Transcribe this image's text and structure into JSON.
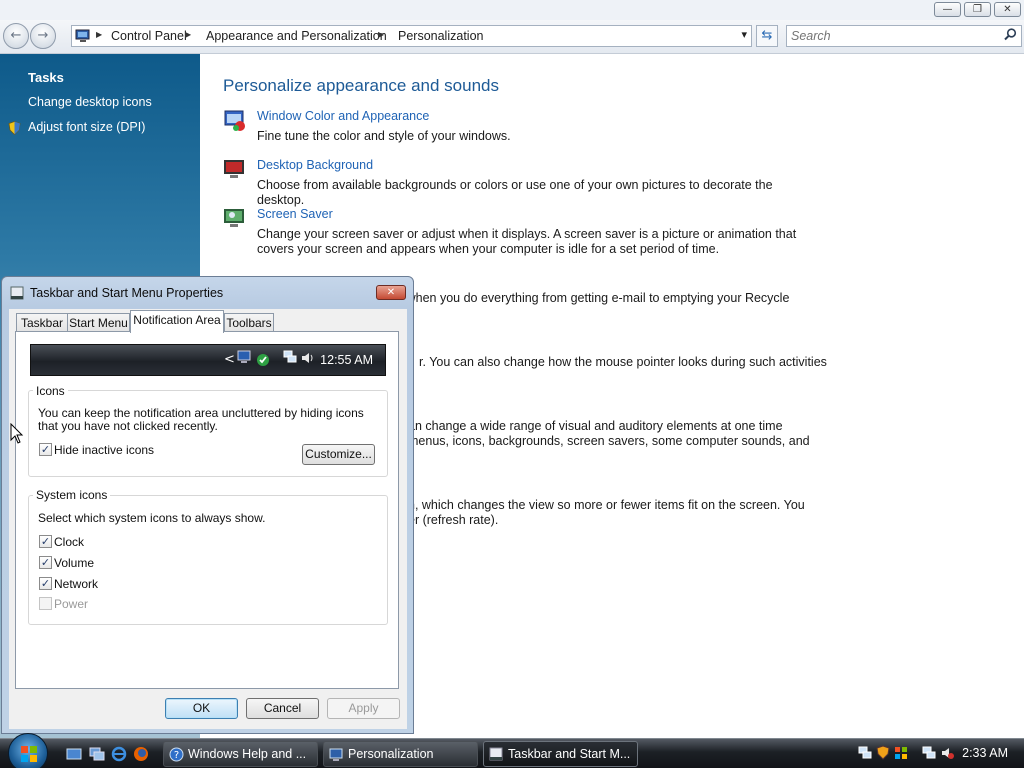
{
  "window": {
    "minimize_glyph": "—",
    "maximize_glyph": "❐",
    "close_glyph": "✕"
  },
  "address_bar": {
    "back_glyph": "←",
    "forward_glyph": "→",
    "crumbs": [
      "Control Panel",
      "Appearance and Personalization",
      "Personalization"
    ],
    "dropdown_glyph": "▾",
    "refresh_glyph": "⇆"
  },
  "search": {
    "placeholder": "Search",
    "icon": "search-icon"
  },
  "left_pane": {
    "heading": "Tasks",
    "tasks": [
      {
        "label": "Change desktop icons"
      },
      {
        "label": "Adjust font size (DPI)",
        "icon": "shield-icon"
      }
    ]
  },
  "content": {
    "title": "Personalize appearance and sounds",
    "items": [
      {
        "title": "Window Color and Appearance",
        "description": "Fine tune the color and style of your windows."
      },
      {
        "title": "Desktop Background",
        "description": "Choose from available backgrounds or colors or use one of your own pictures to decorate the desktop."
      },
      {
        "title": "Screen Saver",
        "description": "Change your screen saver or adjust when it displays. A screen saver is a picture or animation that covers your screen and appears when your computer is idle for a set period of time."
      }
    ],
    "partial_lines": [
      "rd when you do everything from getting e-mail to emptying your Recycle",
      "r. You can also change how the mouse pointer looks during such activities",
      "an change a wide range of visual and auditory elements at one time",
      "menus, icons, backgrounds, screen savers, some computer sounds, and",
      "n, which changes the view so more or fewer items fit on the screen. You",
      "er (refresh rate)."
    ]
  },
  "dialog": {
    "title": "Taskbar and Start Menu Properties",
    "close_glyph": "✕",
    "tabs": [
      "Taskbar",
      "Start Menu",
      "Notification Area",
      "Toolbars"
    ],
    "active_tab": "Notification Area",
    "preview": {
      "chevron": "<",
      "clock": "12:55 AM"
    },
    "icons_group": {
      "title": "Icons",
      "description": "You can keep the notification area uncluttered by hiding icons that you have not clicked recently.",
      "hide_inactive": {
        "label": "Hide inactive icons",
        "checked": true
      },
      "customize_label": "Customize..."
    },
    "system_icons_group": {
      "title": "System icons",
      "description": "Select which system icons to always show.",
      "options": [
        {
          "label": "Clock",
          "checked": true,
          "enabled": true
        },
        {
          "label": "Volume",
          "checked": true,
          "enabled": true
        },
        {
          "label": "Network",
          "checked": true,
          "enabled": true
        },
        {
          "label": "Power",
          "checked": false,
          "enabled": false
        }
      ]
    },
    "buttons": {
      "ok": "OK",
      "cancel": "Cancel",
      "apply": "Apply"
    },
    "check_glyph": "✓"
  },
  "taskbar": {
    "buttons": [
      {
        "label": "Windows Help and ...",
        "icon": "help-icon"
      },
      {
        "label": "Personalization",
        "icon": "control-panel-icon"
      },
      {
        "label": "Taskbar and Start M...",
        "icon": "taskbar-properties-icon",
        "active": true
      }
    ],
    "clock": "2:33 AM"
  }
}
